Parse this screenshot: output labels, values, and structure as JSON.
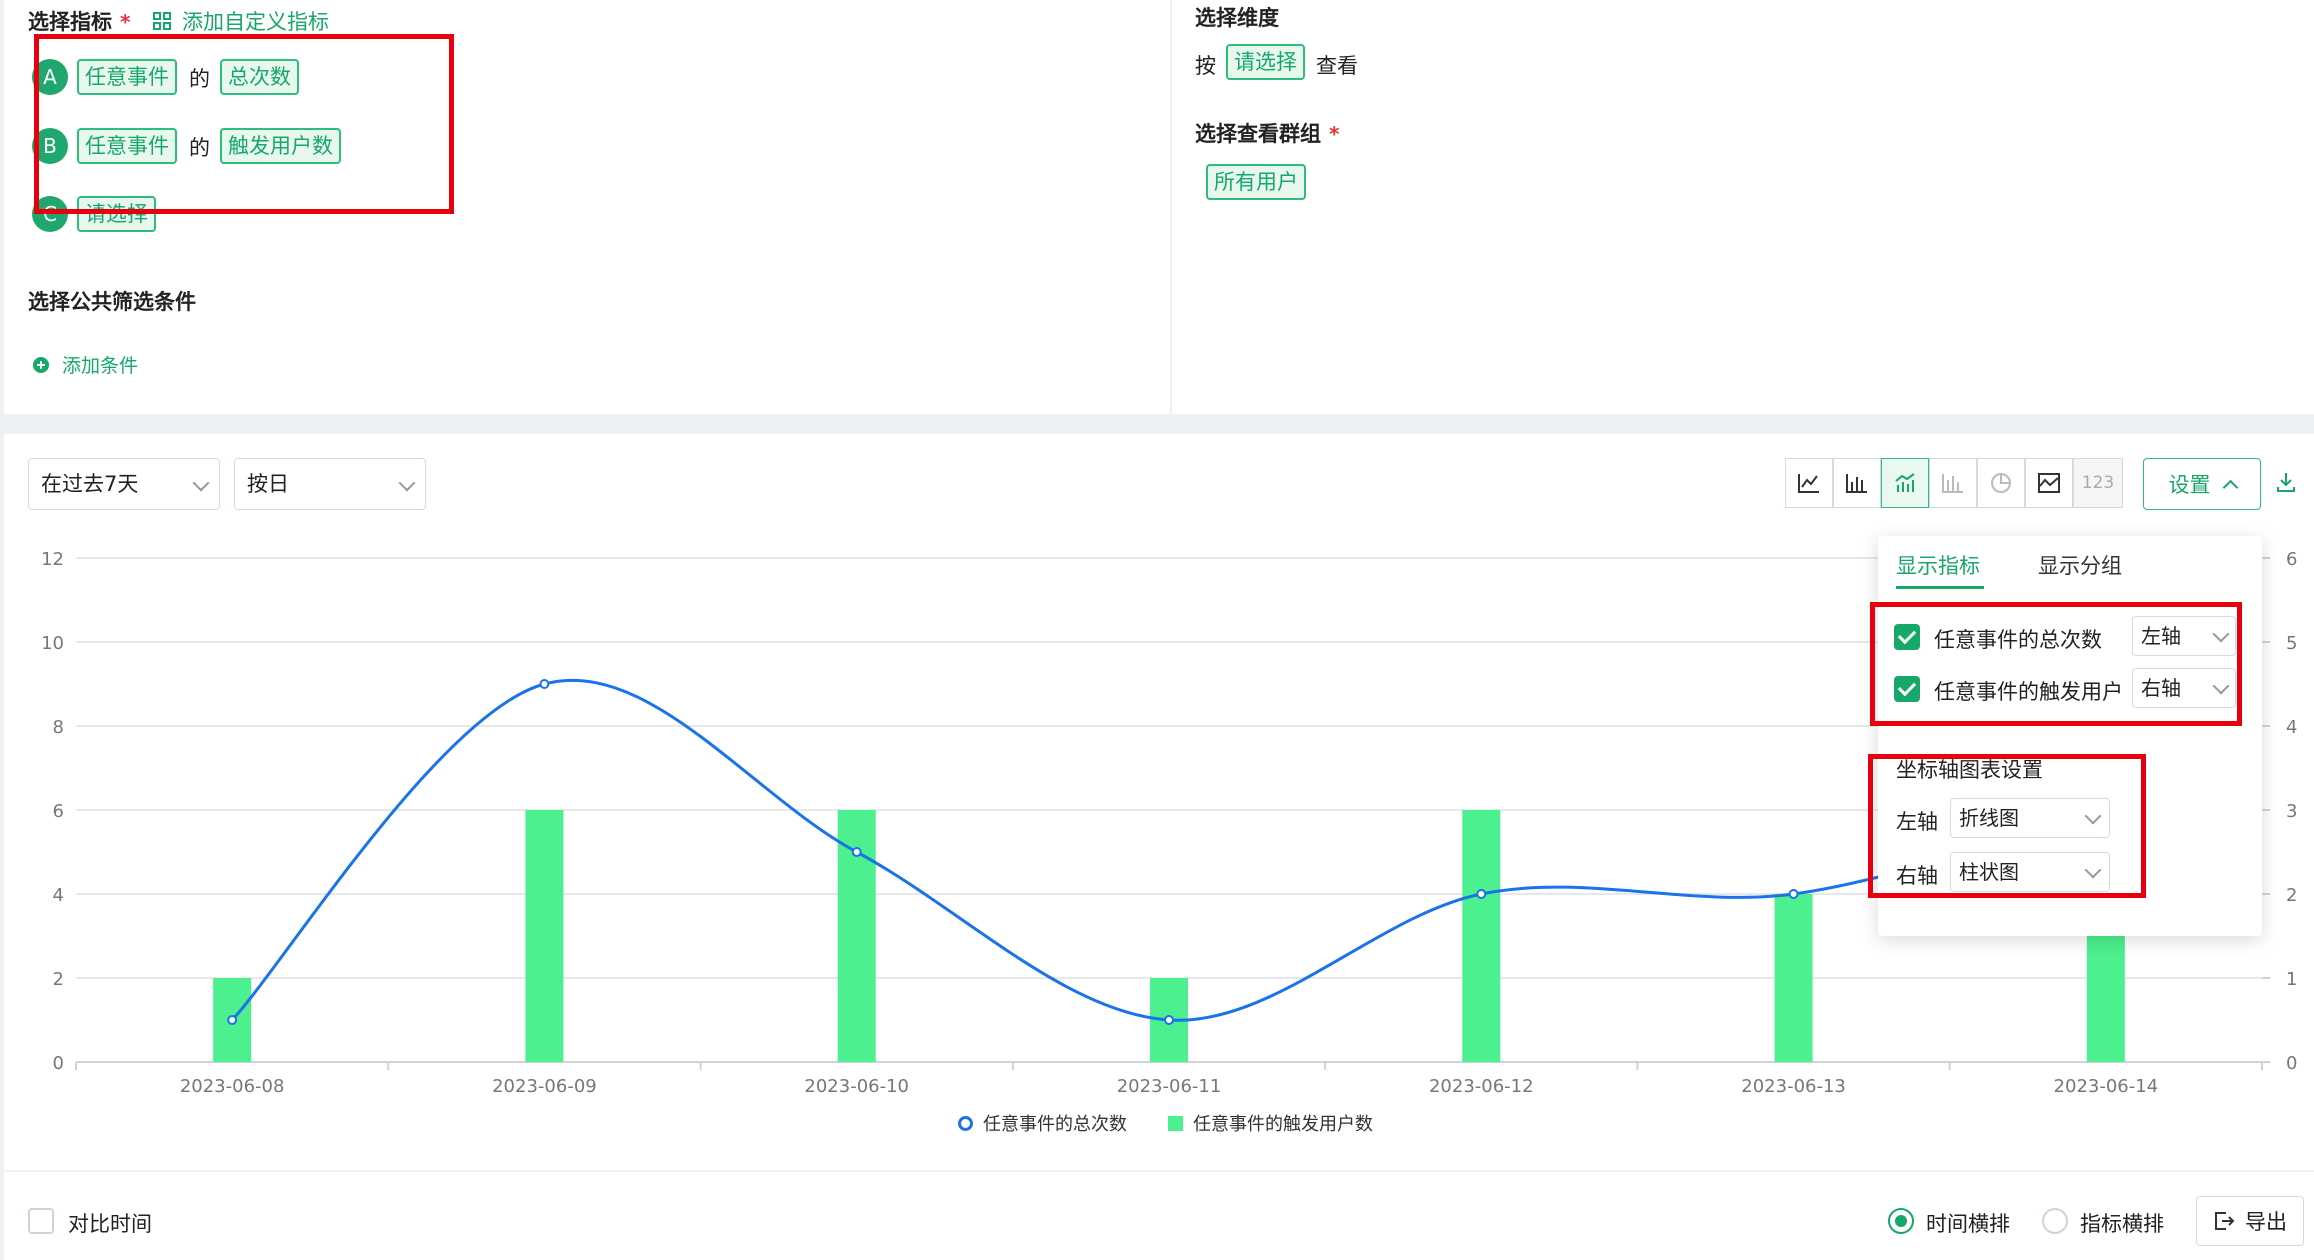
{
  "metrics": {
    "title": "选择指标",
    "required_mark": "*",
    "add_custom_label": "添加自定义指标",
    "items": [
      {
        "letter": "A",
        "event": "任意事件",
        "connector": "的",
        "measure": "总次数"
      },
      {
        "letter": "B",
        "event": "任意事件",
        "connector": "的",
        "measure": "触发用户数"
      },
      {
        "letter": "C",
        "placeholder": "请选择"
      }
    ]
  },
  "filters": {
    "title": "选择公共筛选条件",
    "add_condition_label": "添加条件"
  },
  "dimension": {
    "title": "选择维度",
    "prefix": "按",
    "select_label": "请选择",
    "suffix": "查看"
  },
  "group": {
    "title": "选择查看群组",
    "required_mark": "*",
    "value": "所有用户"
  },
  "controls": {
    "time_range": "在过去7天",
    "granularity": "按日",
    "settings_label": "设置",
    "number_button_label": "123"
  },
  "settings_popover": {
    "tabs": [
      "显示指标",
      "显示分组"
    ],
    "active_tab": 0,
    "metrics": [
      {
        "label": "任意事件的总次数",
        "axis": "左轴",
        "checked": true
      },
      {
        "label": "任意事件的触发用户",
        "axis": "右轴",
        "checked": true
      }
    ],
    "axis_section_title": "坐标轴图表设置",
    "axis_settings": [
      {
        "axis": "左轴",
        "chart": "折线图"
      },
      {
        "axis": "右轴",
        "chart": "柱状图"
      }
    ]
  },
  "chart_data": {
    "type": "bar+line",
    "categories": [
      "2023-06-08",
      "2023-06-09",
      "2023-06-10",
      "2023-06-11",
      "2023-06-12",
      "2023-06-13",
      "2023-06-14"
    ],
    "series": [
      {
        "name": "任意事件的总次数",
        "type": "line",
        "axis": "left",
        "values": [
          1,
          9,
          5,
          1,
          4,
          4,
          6
        ],
        "color": "#1a73e8"
      },
      {
        "name": "任意事件的触发用户数",
        "type": "bar",
        "axis": "right",
        "values": [
          1,
          3,
          3,
          1,
          3,
          2,
          2
        ],
        "color": "#4cf08f"
      }
    ],
    "left_axis": {
      "range": [
        0,
        12
      ],
      "ticks": [
        "0",
        "2",
        "4",
        "6",
        "8",
        "10",
        "12"
      ]
    },
    "right_axis": {
      "range": [
        0,
        6
      ],
      "ticks": [
        "0",
        "1",
        "2",
        "3",
        "4",
        "5",
        "6"
      ]
    },
    "grid": true,
    "legend_position": "bottom"
  },
  "footer": {
    "compare_label": "对比时间",
    "layout_options": [
      "时间横排",
      "指标横排"
    ],
    "selected_layout": 0,
    "export_label": "导出"
  },
  "colors": {
    "brand": "#16a868",
    "highlight": "#e6000f",
    "line": "#1a73e8",
    "bar": "#4cf08f"
  }
}
